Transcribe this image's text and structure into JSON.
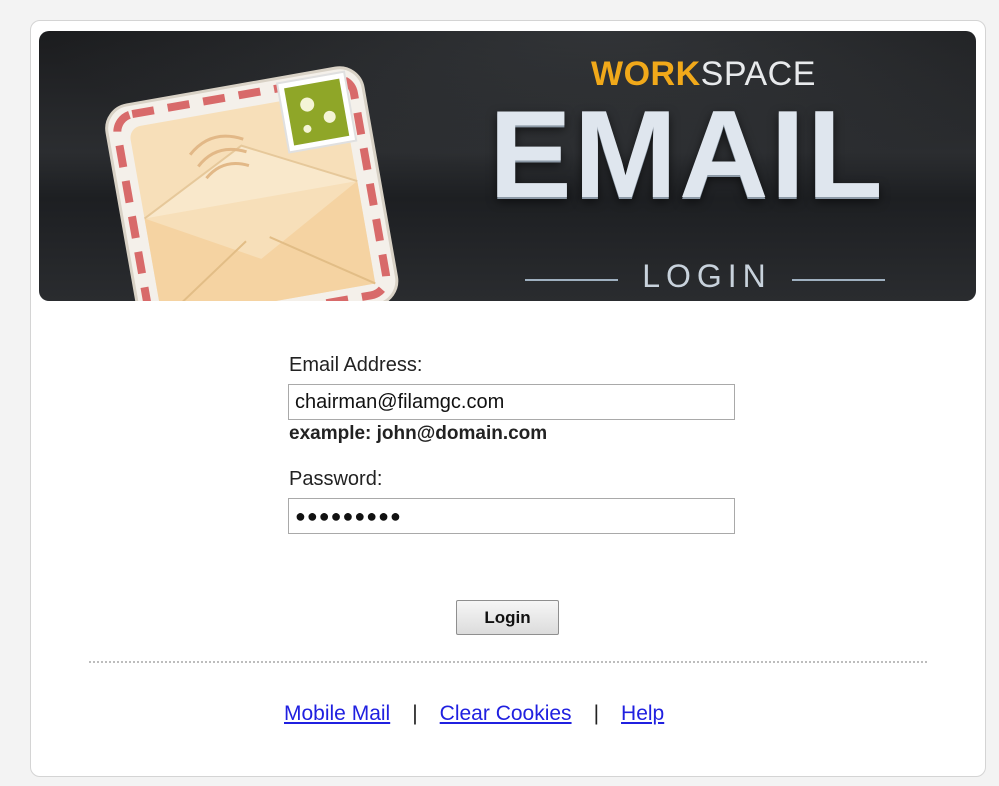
{
  "banner": {
    "workspace_bold": "WORK",
    "workspace_rest": "SPACE",
    "email": "EMAIL",
    "login": "LOGIN"
  },
  "form": {
    "email_label": "Email Address:",
    "email_value": "chairman@filamgc.com",
    "email_hint": "example: john@domain.com",
    "password_label": "Password:",
    "password_value": "●●●●●●●●●",
    "login_button": "Login"
  },
  "footer": {
    "links": [
      "Mobile Mail",
      "Clear Cookies",
      "Help"
    ],
    "separator": "|"
  },
  "colors": {
    "link": "#2020e0",
    "accent": "#f1a91a",
    "banner_bg": "#1f2124"
  }
}
